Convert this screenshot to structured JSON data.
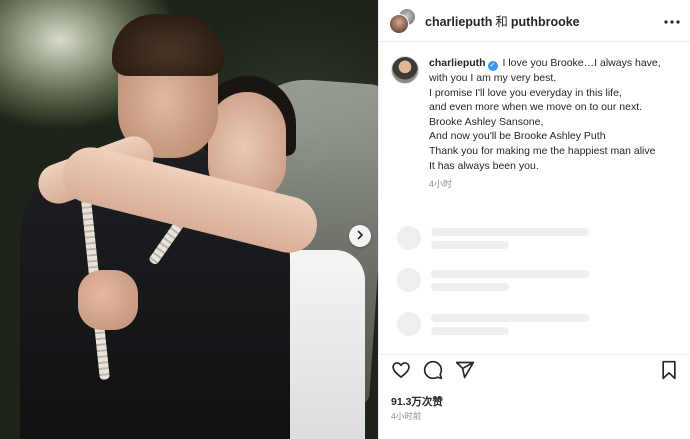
{
  "header": {
    "user1": "charlieputh",
    "connector": "和",
    "user2": "puthbrooke",
    "more_icon": "more-horizontal-icon"
  },
  "caption": {
    "username": "charlieputh",
    "lines": [
      "I love you Brooke…I always have,",
      "with you I am my very best.",
      "I promise I'll love you everyday in this life,",
      "and even more when we move on to our next.",
      "Brooke Ashley Sansone,",
      "And now you'll be Brooke Ashley Puth",
      "Thank you for making me the happiest man alive",
      "It has always been you."
    ],
    "time": "4小时"
  },
  "engagement": {
    "likes": "91.3万次赞",
    "time": "4小时前"
  },
  "icons": {
    "like": "heart-icon",
    "comment": "comment-icon",
    "share": "share-icon",
    "save": "bookmark-icon",
    "next": "chevron-right-icon"
  },
  "colors": {
    "verified": "#3897f0",
    "skeleton": "#efefef",
    "text": "#262626",
    "muted": "#8e8e8e"
  }
}
